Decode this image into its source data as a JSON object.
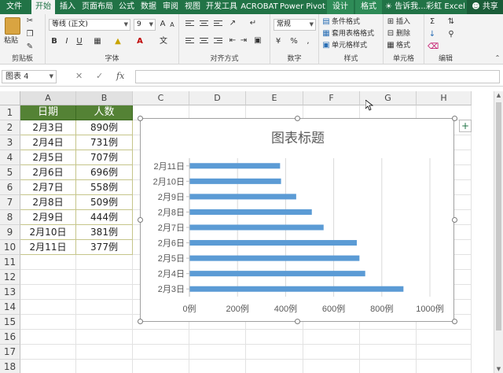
{
  "tabs": {
    "file": "文件",
    "home": "开始",
    "insert": "插入",
    "page_layout": "页面布局",
    "formulas": "公式",
    "data": "数据",
    "review": "审阅",
    "view": "视图",
    "developer": "开发工具",
    "acrobat": "ACROBAT",
    "power_pivot": "Power Pivot",
    "design": "设计",
    "format": "格式",
    "tell_me": "告诉我...",
    "user": "彩虹 Excel",
    "share": "共享"
  },
  "ribbon": {
    "clipboard": {
      "label": "剪贴板",
      "paste": "粘贴"
    },
    "font": {
      "label": "字体",
      "name": "等线 (正文)",
      "size": "9",
      "bold": "B",
      "italic": "I",
      "underline": "U"
    },
    "alignment": {
      "label": "对齐方式"
    },
    "number": {
      "label": "数字",
      "format": "常规",
      "percent": "%"
    },
    "styles": {
      "label": "样式",
      "conditional": "条件格式",
      "table": "套用表格格式",
      "cell_styles": "单元格样式"
    },
    "cells": {
      "label": "单元格",
      "insert": "插入",
      "delete": "删除",
      "format": "格式"
    },
    "editing": {
      "label": "编辑"
    }
  },
  "formula_bar": {
    "name_box": "图表 4",
    "fx": "fx",
    "value": ""
  },
  "grid": {
    "columns": [
      "A",
      "B",
      "C",
      "D",
      "E",
      "F",
      "G",
      "H"
    ],
    "rows": [
      "1",
      "2",
      "3",
      "4",
      "5",
      "6",
      "7",
      "8",
      "9",
      "10",
      "11",
      "12",
      "13",
      "14",
      "15",
      "16",
      "17",
      "18"
    ],
    "headers": [
      "日期",
      "人数"
    ],
    "data": [
      [
        "2月3日",
        "890例"
      ],
      [
        "2月4日",
        "731例"
      ],
      [
        "2月5日",
        "707例"
      ],
      [
        "2月6日",
        "696例"
      ],
      [
        "2月7日",
        "558例"
      ],
      [
        "2月8日",
        "509例"
      ],
      [
        "2月9日",
        "444例"
      ],
      [
        "2月10日",
        "381例"
      ],
      [
        "2月11日",
        "377例"
      ]
    ]
  },
  "colors": {
    "excel_green": "#217346",
    "header_fill": "#548235",
    "bar_fill": "#5b9bd5",
    "grid_line": "#d9d9d9"
  },
  "chart_data": {
    "type": "bar",
    "orientation": "horizontal",
    "title": "图表标题",
    "categories": [
      "2月3日",
      "2月4日",
      "2月5日",
      "2月6日",
      "2月7日",
      "2月8日",
      "2月9日",
      "2月10日",
      "2月11日"
    ],
    "values": [
      890,
      731,
      707,
      696,
      558,
      509,
      444,
      381,
      377
    ],
    "xlim": [
      0,
      1000
    ],
    "x_ticks": [
      0,
      200,
      400,
      600,
      800,
      1000
    ],
    "x_tick_labels": [
      "0例",
      "200例",
      "400例",
      "600例",
      "800例",
      "1000例"
    ],
    "grid": true,
    "legend": "none"
  }
}
